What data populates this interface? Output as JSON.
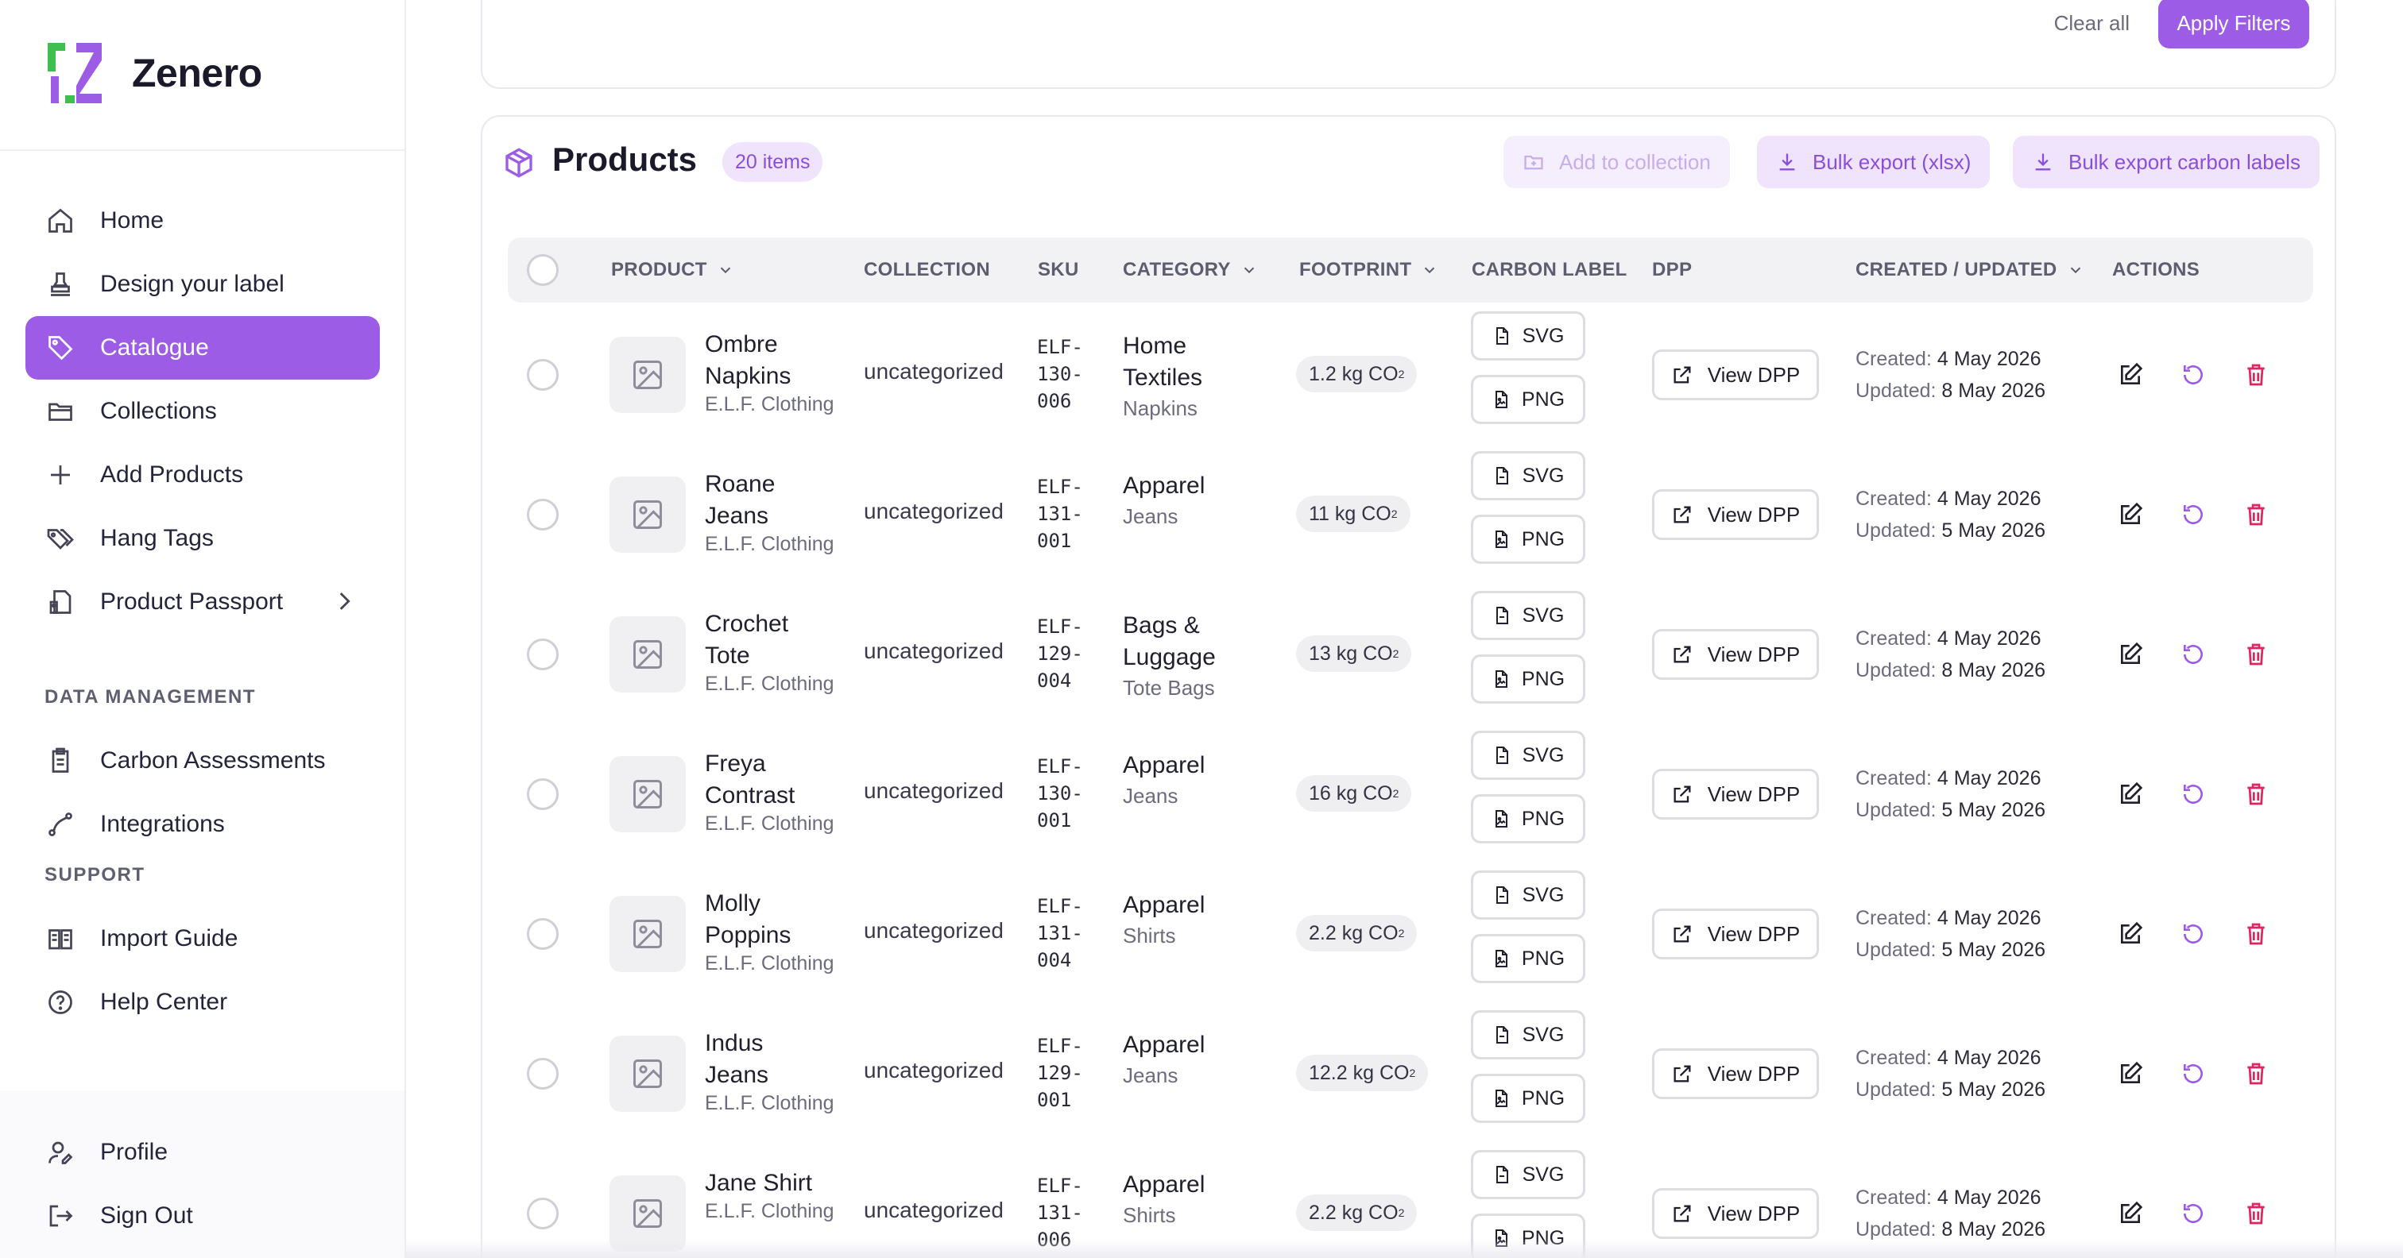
{
  "brand": {
    "name": "Zenero"
  },
  "sidebar": {
    "nav": [
      {
        "label": "Home",
        "icon": "home-icon"
      },
      {
        "label": "Design your label",
        "icon": "stamp-icon"
      },
      {
        "label": "Catalogue",
        "icon": "tag-icon",
        "active": true
      },
      {
        "label": "Collections",
        "icon": "folder-icon"
      },
      {
        "label": "Add Products",
        "icon": "plus-icon"
      },
      {
        "label": "Hang Tags",
        "icon": "tags-icon"
      },
      {
        "label": "Product Passport",
        "icon": "passport-icon"
      }
    ],
    "data_management_label": "DATA MANAGEMENT",
    "data_management": [
      {
        "label": "Carbon Assessments",
        "icon": "clipboard-icon"
      },
      {
        "label": "Integrations",
        "icon": "route-icon"
      }
    ],
    "support_label": "SUPPORT",
    "support": [
      {
        "label": "Import Guide",
        "icon": "book-icon"
      },
      {
        "label": "Help Center",
        "icon": "help-icon"
      }
    ],
    "bottom": [
      {
        "label": "Profile",
        "icon": "user-icon"
      },
      {
        "label": "Sign Out",
        "icon": "sign-out-icon"
      }
    ]
  },
  "filters": {
    "clear_label": "Clear all",
    "apply_label": "Apply Filters"
  },
  "products": {
    "title": "Products",
    "count": "20 items",
    "add_to_collection": "Add to collection",
    "bulk_export": "Bulk export (xlsx)",
    "bulk_export_labels": "Bulk export carbon labels",
    "columns": {
      "product": "PRODUCT",
      "collection": "COLLECTION",
      "sku": "SKU",
      "category": "CATEGORY",
      "footprint": "FOOTPRINT",
      "carbon_label": "CARBON LABEL",
      "dpp": "DPP",
      "created_updated": "CREATED / UPDATED",
      "actions": "ACTIONS"
    },
    "svg_label": "SVG",
    "png_label": "PNG",
    "view_dpp": "View DPP",
    "created_prefix": "Created:",
    "updated_prefix": "Updated:",
    "footprint_unit": "kg CO",
    "footprint_sub": "2",
    "rows": [
      {
        "name1": "Ombre",
        "name2": "Napkins",
        "brand": "E.L.F. Clothing",
        "collection": "uncategorized",
        "sku": "ELF-\n130-\n006",
        "cat1": "Home",
        "cat2": "Textiles",
        "subcat": "Napkins",
        "footprint": "1.2",
        "created": "4 May 2026",
        "updated": "8 May 2026"
      },
      {
        "name1": "Roane",
        "name2": "Jeans",
        "brand": "E.L.F. Clothing",
        "collection": "uncategorized",
        "sku": "ELF-\n131-\n001",
        "cat1": "Apparel",
        "cat2": "",
        "subcat": "Jeans",
        "footprint": "11",
        "created": "4 May 2026",
        "updated": "5 May 2026"
      },
      {
        "name1": "Crochet",
        "name2": "Tote",
        "brand": "E.L.F. Clothing",
        "collection": "uncategorized",
        "sku": "ELF-\n129-\n004",
        "cat1": "Bags &",
        "cat2": "Luggage",
        "subcat": "Tote Bags",
        "footprint": "13",
        "created": "4 May 2026",
        "updated": "8 May 2026"
      },
      {
        "name1": "Freya",
        "name2": "Contrast",
        "brand": "E.L.F. Clothing",
        "collection": "uncategorized",
        "sku": "ELF-\n130-\n001",
        "cat1": "Apparel",
        "cat2": "",
        "subcat": "Jeans",
        "footprint": "16",
        "created": "4 May 2026",
        "updated": "5 May 2026"
      },
      {
        "name1": "Molly",
        "name2": "Poppins",
        "brand": "E.L.F. Clothing",
        "collection": "uncategorized",
        "sku": "ELF-\n131-\n004",
        "cat1": "Apparel",
        "cat2": "",
        "subcat": "Shirts",
        "footprint": "2.2",
        "created": "4 May 2026",
        "updated": "5 May 2026"
      },
      {
        "name1": "Indus",
        "name2": "Jeans",
        "brand": "E.L.F. Clothing",
        "collection": "uncategorized",
        "sku": "ELF-\n129-\n001",
        "cat1": "Apparel",
        "cat2": "",
        "subcat": "Jeans",
        "footprint": "12.2",
        "created": "4 May 2026",
        "updated": "5 May 2026"
      },
      {
        "name1": "Jane Shirt",
        "name2": "",
        "brand": "E.L.F. Clothing",
        "collection": "uncategorized",
        "sku": "ELF-\n131-\n006",
        "cat1": "Apparel",
        "cat2": "",
        "subcat": "Shirts",
        "footprint": "2.2",
        "created": "4 May 2026",
        "updated": "8 May 2026"
      }
    ]
  },
  "colors": {
    "accent": "#9d5ce6",
    "accent_soft": "#efe4fc",
    "danger": "#e0245e",
    "logo_green": "#3fbf4f"
  }
}
